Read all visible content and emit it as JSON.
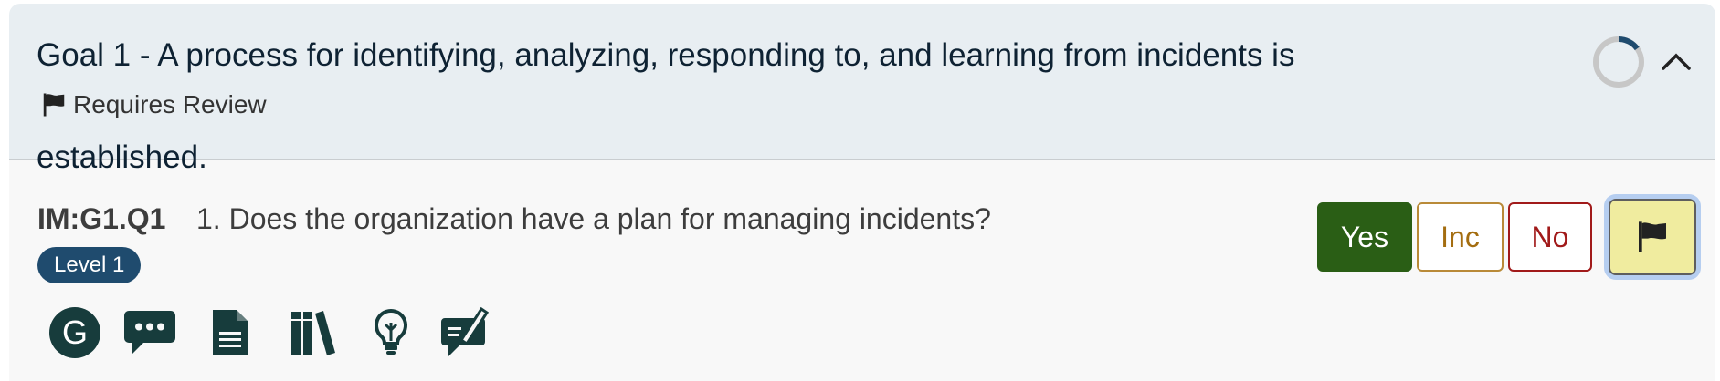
{
  "goal": {
    "title": "Goal 1 - A process for identifying, analyzing, responding to, and learning from incidents is",
    "title_cont": "established.",
    "review_label": "Requires Review",
    "progress_fraction": 0.15
  },
  "question": {
    "id": "IM:G1.Q1",
    "text": "1. Does the organization have a plan for managing incidents?",
    "level": "Level 1",
    "answers": {
      "yes": "Yes",
      "inc": "Inc",
      "no": "No"
    },
    "selected": "flag"
  },
  "toolbar": {
    "guidance_letter": "G",
    "icons": [
      "guidance-icon",
      "comments-icon",
      "document-icon",
      "references-icon",
      "observations-icon",
      "review-notes-icon"
    ]
  },
  "colors": {
    "header_bg": "#e8eef2",
    "icon": "#173c3c",
    "yes": "#2a5e15",
    "inc": "#a46d10",
    "no": "#a11a1a",
    "flag_bg": "#f0ec9f",
    "badge": "#1f4b6e"
  }
}
